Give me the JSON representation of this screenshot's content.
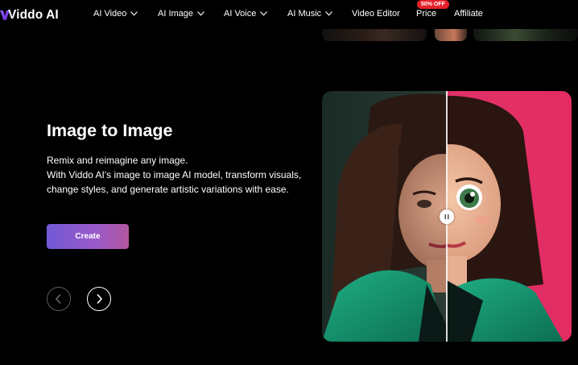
{
  "nav": {
    "logo": "Viddo AI",
    "items": [
      {
        "label": "AI Video",
        "dropdown": true
      },
      {
        "label": "AI Image",
        "dropdown": true
      },
      {
        "label": "AI Voice",
        "dropdown": true
      },
      {
        "label": "AI Music",
        "dropdown": true
      },
      {
        "label": "Video Editor",
        "dropdown": false
      },
      {
        "label": "Price",
        "dropdown": false
      },
      {
        "label": "Affiliate",
        "dropdown": false
      }
    ],
    "price_badge": "50% OFF"
  },
  "hero": {
    "title": "Image to Image",
    "desc_line1": "Remix and reimagine any image.",
    "desc_line2": "With Viddo AI's image to image AI model, transform visuals, change styles, and generate artistic variations with ease.",
    "create_label": "Create"
  },
  "colors": {
    "background": "#000000",
    "accent_start": "#7259d7",
    "accent_end": "#b2589e",
    "badge": "#e6212a"
  },
  "icons": {
    "prev": "chevron-left-icon",
    "next": "chevron-right-icon",
    "compare_handle": "pause-handle-icon"
  }
}
